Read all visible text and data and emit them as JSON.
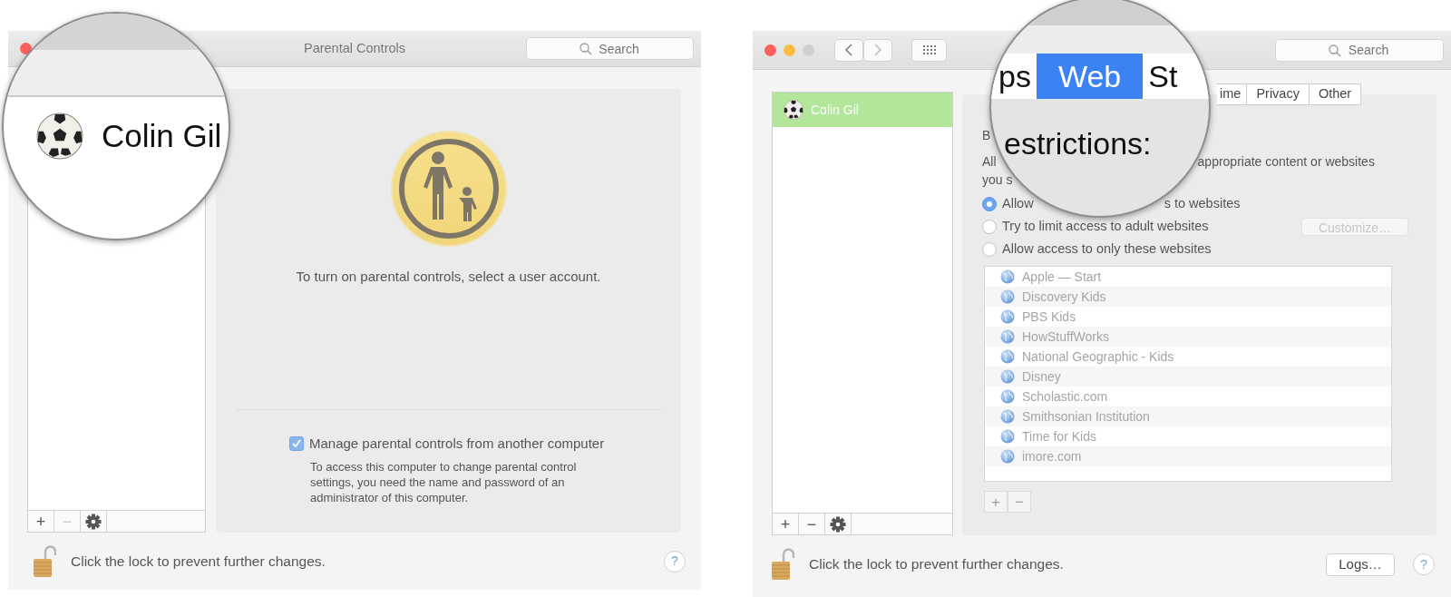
{
  "left_window": {
    "title": "Parental Controls",
    "search": {
      "placeholder": "Search"
    },
    "list_buttons": [
      {
        "label": "+",
        "disabled": false
      },
      {
        "label": "−",
        "disabled": true
      }
    ],
    "message": "To turn on parental controls, select a user account.",
    "remote_management": {
      "label": "Manage parental controls from another computer",
      "checked": true,
      "description": "To access this computer to change parental control settings, you need the name and password of an administrator of this computer."
    },
    "lock_message": "Click the lock to prevent further changes.",
    "help_label": "?",
    "magnifier": {
      "user_name": "Colin Gil"
    }
  },
  "right_window": {
    "search": {
      "placeholder": "Search"
    },
    "users": [
      {
        "name": "Colin Gil",
        "selected": true
      }
    ],
    "list_buttons": [
      {
        "label": "+",
        "disabled": false
      },
      {
        "label": "−",
        "disabled": false
      }
    ],
    "tabs": [
      {
        "label": "ime",
        "selected": false
      },
      {
        "label": "Privacy",
        "selected": false
      },
      {
        "label": "Other",
        "selected": false
      }
    ],
    "text_lines": [
      [
        "B"
      ],
      [
        "All",
        "appropriate content or websites"
      ],
      [
        "you s"
      ]
    ],
    "options": [
      {
        "label": "Allow",
        "label_tail": "s to websites",
        "selected": true
      },
      {
        "label": "Try to limit access to adult websites",
        "selected": false
      },
      {
        "label": "Allow access to only these websites",
        "selected": false
      }
    ],
    "customize_button": {
      "label": "Customize…",
      "disabled": true
    },
    "websites": {
      "disabled": true,
      "items": [
        "Apple — Start",
        "Discovery Kids",
        "PBS Kids",
        "HowStuffWorks",
        "National Geographic - Kids",
        "Disney",
        "Scholastic.com",
        "Smithsonian Institution",
        "Time for Kids",
        "imore.com"
      ]
    },
    "website_buttons": [
      {
        "label": "+",
        "disabled": true
      },
      {
        "label": "−",
        "disabled": true
      }
    ],
    "lock_message": "Click the lock to prevent further changes.",
    "logs_button": "Logs…",
    "help_label": "?",
    "magnifier": {
      "tabs": [
        {
          "label": "ps",
          "selected": false
        },
        {
          "label": "Web",
          "selected": true
        },
        {
          "label": "St",
          "selected": false
        }
      ],
      "heading": "estrictions:"
    }
  }
}
